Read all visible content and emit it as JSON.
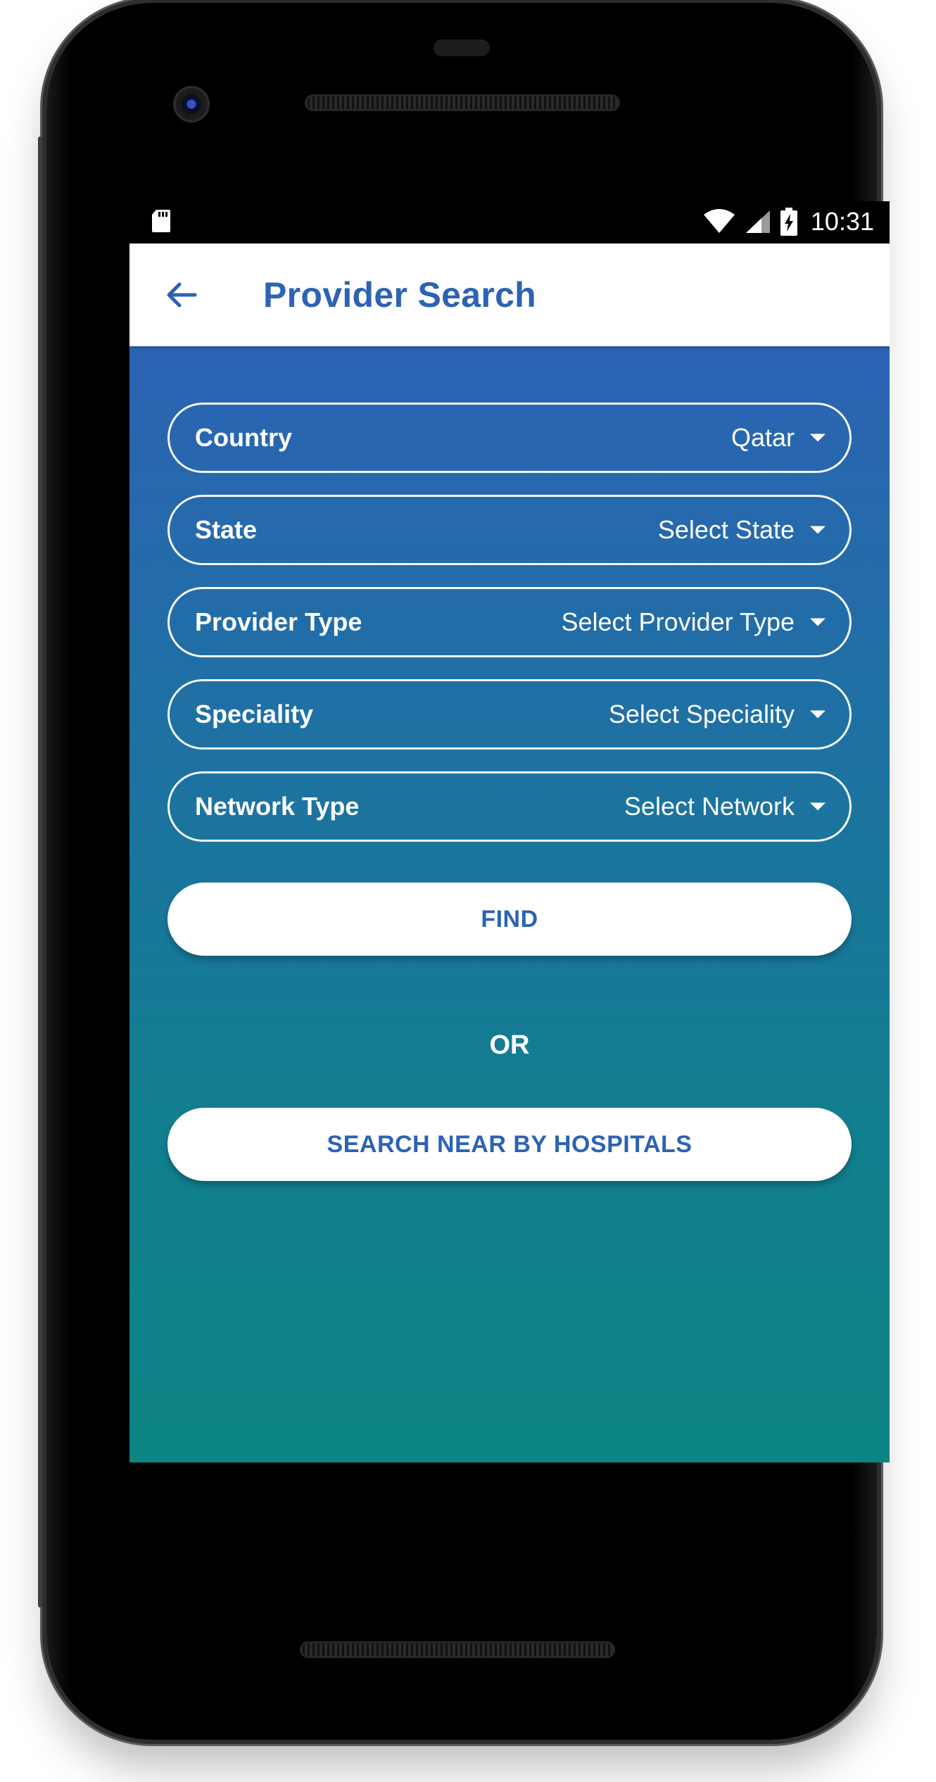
{
  "status_bar": {
    "time": "10:31",
    "icons": [
      "sd-card-icon",
      "wifi-icon",
      "cell-signal-icon",
      "battery-charging-icon"
    ]
  },
  "app_bar": {
    "back_icon": "arrow-back-icon",
    "title": "Provider Search",
    "title_color": "#2c63b3"
  },
  "form": {
    "fields": [
      {
        "label": "Country",
        "value": "Qatar"
      },
      {
        "label": "State",
        "value": "Select State"
      },
      {
        "label": "Provider Type",
        "value": "Select Provider Type"
      },
      {
        "label": "Speciality",
        "value": "Select Speciality"
      },
      {
        "label": "Network Type",
        "value": "Select Network"
      }
    ]
  },
  "actions": {
    "find_label": "FIND",
    "or_label": "OR",
    "nearby_label": "SEARCH NEAR BY HOSPITALS"
  },
  "nav_bar": {
    "icons": [
      "nav-back-icon",
      "nav-home-icon",
      "nav-recents-icon"
    ]
  },
  "colors": {
    "gradient_top": "#2c63b4",
    "gradient_bottom": "#0c8484",
    "accent": "#2c63b3"
  }
}
